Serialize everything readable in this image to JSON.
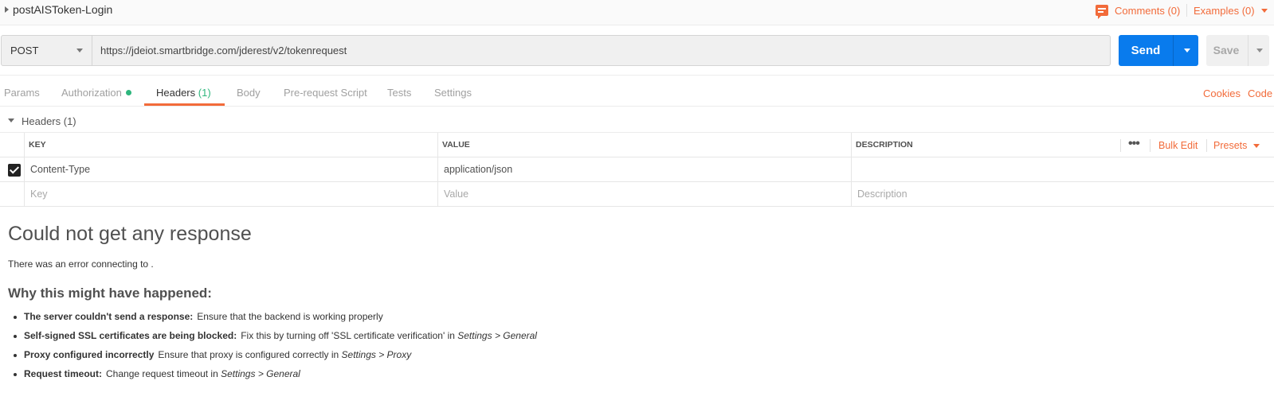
{
  "request": {
    "name": "postAISToken-Login",
    "comments_label": "Comments (0)",
    "examples_label": "Examples (0)",
    "method": "POST",
    "url": "https://jdeiot.smartbridge.com/jderest/v2/tokenrequest",
    "send_label": "Send",
    "save_label": "Save"
  },
  "tabs": [
    {
      "label": "Params",
      "active": false
    },
    {
      "label": "Authorization",
      "active": false,
      "indicator": "green-dot"
    },
    {
      "label": "Headers",
      "count": "(1)",
      "active": true
    },
    {
      "label": "Body",
      "active": false
    },
    {
      "label": "Pre-request Script",
      "active": false
    },
    {
      "label": "Tests",
      "active": false
    },
    {
      "label": "Settings",
      "active": false
    }
  ],
  "tab_links": {
    "cookies": "Cookies",
    "code": "Code"
  },
  "headers_section": {
    "title": "Headers (1)",
    "columns": {
      "key": "KEY",
      "value": "VALUE",
      "description": "DESCRIPTION"
    },
    "tools": {
      "more_icon": "ellipsis-icon",
      "bulk_edit": "Bulk Edit",
      "presets": "Presets"
    },
    "rows": [
      {
        "checked": true,
        "key": "Content-Type",
        "value": "application/json",
        "description": ""
      }
    ],
    "new_row": {
      "key_placeholder": "Key",
      "value_placeholder": "Value",
      "description_placeholder": "Description"
    }
  },
  "response": {
    "title": "Could not get any response",
    "message": "There was an error connecting to .",
    "why_title": "Why this might have happened:",
    "reasons": [
      {
        "bold": "The server couldn't send a response:",
        "text": "Ensure that the backend is working properly",
        "italic": ""
      },
      {
        "bold": "Self-signed SSL certificates are being blocked:",
        "text": "Fix this by turning off 'SSL certificate verification' in",
        "italic": "Settings > General"
      },
      {
        "bold": "Proxy configured incorrectly",
        "text": "Ensure that proxy is configured correctly in",
        "italic": "Settings > Proxy"
      },
      {
        "bold": "Request timeout:",
        "text": "Change request timeout in",
        "italic": "Settings > General"
      }
    ]
  },
  "colors": {
    "accent": "#f26b3a",
    "send": "#097bed",
    "active_dot": "#2eb67d"
  }
}
